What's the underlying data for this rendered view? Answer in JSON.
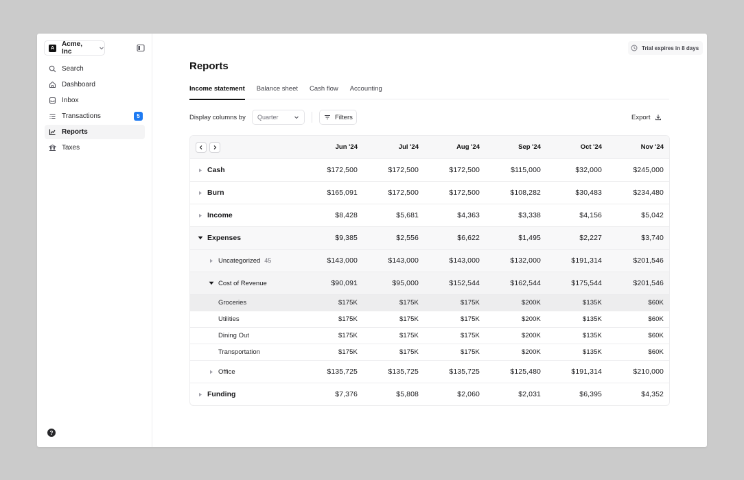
{
  "sidebar": {
    "org": {
      "logo": "A",
      "name": "Acme, Inc"
    },
    "items": [
      {
        "label": "Search",
        "icon": "search-icon"
      },
      {
        "label": "Dashboard",
        "icon": "home-icon"
      },
      {
        "label": "Inbox",
        "icon": "inbox-icon"
      },
      {
        "label": "Transactions",
        "icon": "list-icon",
        "badge": "5"
      },
      {
        "label": "Reports",
        "icon": "chart-icon",
        "active": true
      },
      {
        "label": "Taxes",
        "icon": "bank-icon"
      }
    ],
    "help": "?"
  },
  "header": {
    "trial": "Trial expires in 8 days"
  },
  "page": {
    "title": "Reports",
    "tabs": [
      "Income statement",
      "Balance sheet",
      "Cash flow",
      "Accounting"
    ],
    "display_label": "Display columns by",
    "select_placeholder": "Quarter",
    "filters_label": "Filters",
    "export_label": "Export"
  },
  "table": {
    "columns": [
      "Jun '24",
      "Jul '24",
      "Aug '24",
      "Sep '24",
      "Oct '24",
      "Nov '24"
    ],
    "rows": {
      "cash": {
        "label": "Cash",
        "values": [
          "$172,500",
          "$172,500",
          "$172,500",
          "$115,000",
          "$32,000",
          "$245,000"
        ]
      },
      "burn": {
        "label": "Burn",
        "values": [
          "$165,091",
          "$172,500",
          "$172,500",
          "$108,282",
          "$30,483",
          "$234,480"
        ]
      },
      "income": {
        "label": "Income",
        "values": [
          "$8,428",
          "$5,681",
          "$4,363",
          "$3,338",
          "$4,156",
          "$5,042"
        ]
      },
      "expenses": {
        "label": "Expenses",
        "values": [
          "$9,385",
          "$2,556",
          "$6,622",
          "$1,495",
          "$2,227",
          "$3,740"
        ]
      },
      "uncategorized": {
        "label": "Uncategorized",
        "count": "45",
        "values": [
          "$143,000",
          "$143,000",
          "$143,000",
          "$132,000",
          "$191,314",
          "$201,546"
        ]
      },
      "cost_of_revenue": {
        "label": "Cost of Revenue",
        "values": [
          "$90,091",
          "$95,000",
          "$152,544",
          "$162,544",
          "$175,544",
          "$201,546"
        ]
      },
      "groceries": {
        "label": "Groceries",
        "values": [
          "$175K",
          "$175K",
          "$175K",
          "$200K",
          "$135K",
          "$60K"
        ]
      },
      "utilities": {
        "label": "Utilities",
        "values": [
          "$175K",
          "$175K",
          "$175K",
          "$200K",
          "$135K",
          "$60K"
        ]
      },
      "dining_out": {
        "label": "Dining Out",
        "values": [
          "$175K",
          "$175K",
          "$175K",
          "$200K",
          "$135K",
          "$60K"
        ]
      },
      "transportation": {
        "label": "Transportation",
        "values": [
          "$175K",
          "$175K",
          "$175K",
          "$200K",
          "$135K",
          "$60K"
        ]
      },
      "office": {
        "label": "Office",
        "values": [
          "$135,725",
          "$135,725",
          "$135,725",
          "$125,480",
          "$191,314",
          "$210,000"
        ]
      },
      "funding": {
        "label": "Funding",
        "values": [
          "$7,376",
          "$5,808",
          "$2,060",
          "$2,031",
          "$6,395",
          "$4,352"
        ]
      }
    }
  }
}
